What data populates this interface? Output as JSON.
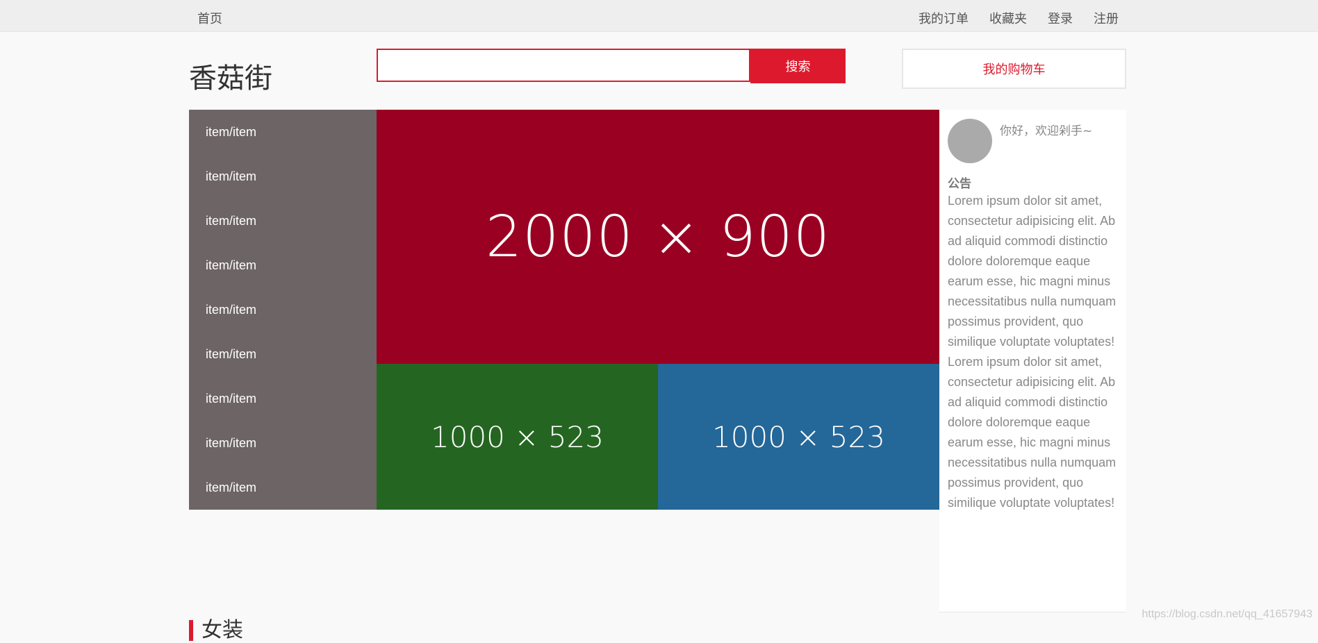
{
  "topbar": {
    "home": "首页",
    "links": [
      "我的订单",
      "收藏夹",
      "登录",
      "注册"
    ]
  },
  "header": {
    "logo": "香菇街",
    "search": {
      "value": "",
      "placeholder": "",
      "button": "搜索"
    },
    "cart": "我的购物车"
  },
  "categories": [
    "item/item",
    "item/item",
    "item/item",
    "item/item",
    "item/item",
    "item/item",
    "item/item",
    "item/item",
    "item/item"
  ],
  "banners": {
    "main": "2000 × 900",
    "sub_left": "1000 × 523",
    "sub_right": "1000 × 523"
  },
  "user_panel": {
    "greeting": "你好，欢迎剁手~",
    "notice_title": "公告",
    "notice_body": "Lorem ipsum dolor sit amet, consectetur adipisicing elit. Ab ad aliquid commodi distinctio dolore doloremque eaque earum esse, hic magni minus necessitatibus nulla numquam possimus provident, quo similique voluptate voluptates! Lorem ipsum dolor sit amet, consectetur adipisicing elit. Ab ad aliquid commodi distinctio dolore doloremque eaque earum esse, hic magni minus necessitatibus nulla numquam possimus provident, quo similique voluptate voluptates!"
  },
  "section": {
    "title": "女装"
  },
  "watermark": "https://blog.csdn.net/qq_41657943",
  "colors": {
    "accent": "#dd1a2d",
    "menu_bg": "#6d6466",
    "banner_main": "#9a0022",
    "banner_green": "#246621",
    "banner_blue": "#246799"
  }
}
